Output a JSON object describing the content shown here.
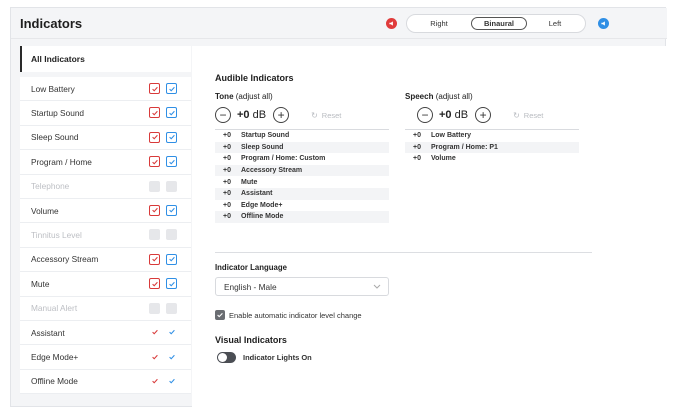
{
  "header": {
    "title": "Indicators",
    "sides": [
      "Right",
      "Binaural",
      "Left"
    ],
    "selected_side": "Binaural",
    "right_color": "#e03b3b",
    "left_color": "#2f8fe5"
  },
  "sidebar": {
    "header": "All Indicators",
    "items": [
      {
        "label": "Low Battery",
        "state": "boxed"
      },
      {
        "label": "Startup Sound",
        "state": "boxed"
      },
      {
        "label": "Sleep Sound",
        "state": "boxed"
      },
      {
        "label": "Program / Home",
        "state": "boxed"
      },
      {
        "label": "Telephone",
        "state": "disabled"
      },
      {
        "label": "Volume",
        "state": "boxed"
      },
      {
        "label": "Tinnitus Level",
        "state": "disabled"
      },
      {
        "label": "Accessory Stream",
        "state": "boxed"
      },
      {
        "label": "Mute",
        "state": "boxed"
      },
      {
        "label": "Manual Alert",
        "state": "disabled"
      },
      {
        "label": "Assistant",
        "state": "plain"
      },
      {
        "label": "Edge Mode+",
        "state": "plain"
      },
      {
        "label": "Offline Mode",
        "state": "plain"
      }
    ]
  },
  "audible": {
    "title": "Audible Indicators",
    "tone": {
      "label": "Tone",
      "hint": "(adjust all)",
      "value": "+0",
      "unit": "dB",
      "reset": "Reset",
      "rows": [
        {
          "v": "+0",
          "n": "Startup Sound"
        },
        {
          "v": "+0",
          "n": "Sleep Sound"
        },
        {
          "v": "+0",
          "n": "Program / Home: Custom"
        },
        {
          "v": "+0",
          "n": "Accessory Stream"
        },
        {
          "v": "+0",
          "n": "Mute"
        },
        {
          "v": "+0",
          "n": "Assistant"
        },
        {
          "v": "+0",
          "n": "Edge Mode+"
        },
        {
          "v": "+0",
          "n": "Offline Mode"
        }
      ]
    },
    "speech": {
      "label": "Speech",
      "hint": "(adjust all)",
      "value": "+0",
      "unit": "dB",
      "reset": "Reset",
      "rows": [
        {
          "v": "+0",
          "n": "Low Battery"
        },
        {
          "v": "+0",
          "n": "Program / Home: P1"
        },
        {
          "v": "+0",
          "n": "Volume"
        }
      ]
    }
  },
  "language": {
    "title": "Indicator Language",
    "selected": "English - Male"
  },
  "auto_level": {
    "label": "Enable automatic indicator level change",
    "checked": true
  },
  "visual": {
    "title": "Visual Indicators",
    "toggle_label": "Indicator Lights On",
    "on": true
  }
}
